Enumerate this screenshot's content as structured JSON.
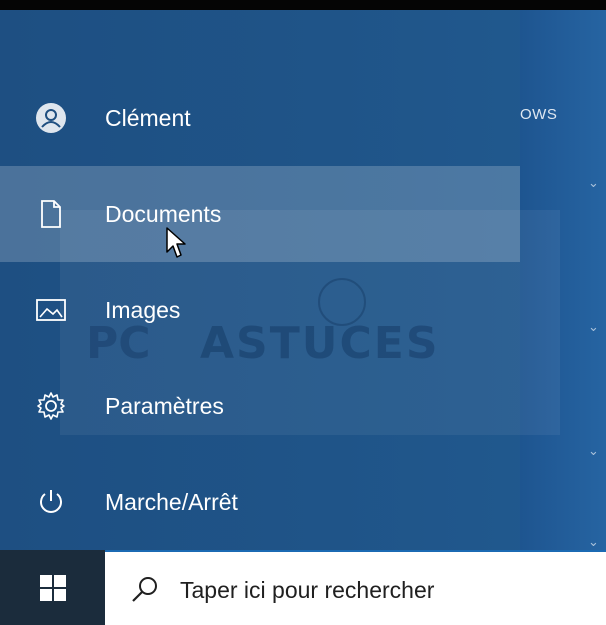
{
  "start_menu": {
    "items": [
      {
        "label": "Clément",
        "icon": "user-avatar-icon"
      },
      {
        "label": "Documents",
        "icon": "document-icon"
      },
      {
        "label": "Images",
        "icon": "image-icon"
      },
      {
        "label": "Paramètres",
        "icon": "gear-icon"
      },
      {
        "label": "Marche/Arrêt",
        "icon": "power-icon"
      }
    ],
    "tiles_header_fragment": "OWS"
  },
  "taskbar": {
    "start_icon": "windows-logo-icon",
    "search": {
      "icon": "search-icon",
      "placeholder": "Taper ici pour rechercher"
    }
  },
  "watermark": {
    "text": "ASTUCES",
    "prefix": "PC"
  },
  "colors": {
    "menu_bg": "#1f5488",
    "hover": "#4a76a3",
    "taskbar": "#101a24",
    "search_bg": "#ffffff"
  }
}
